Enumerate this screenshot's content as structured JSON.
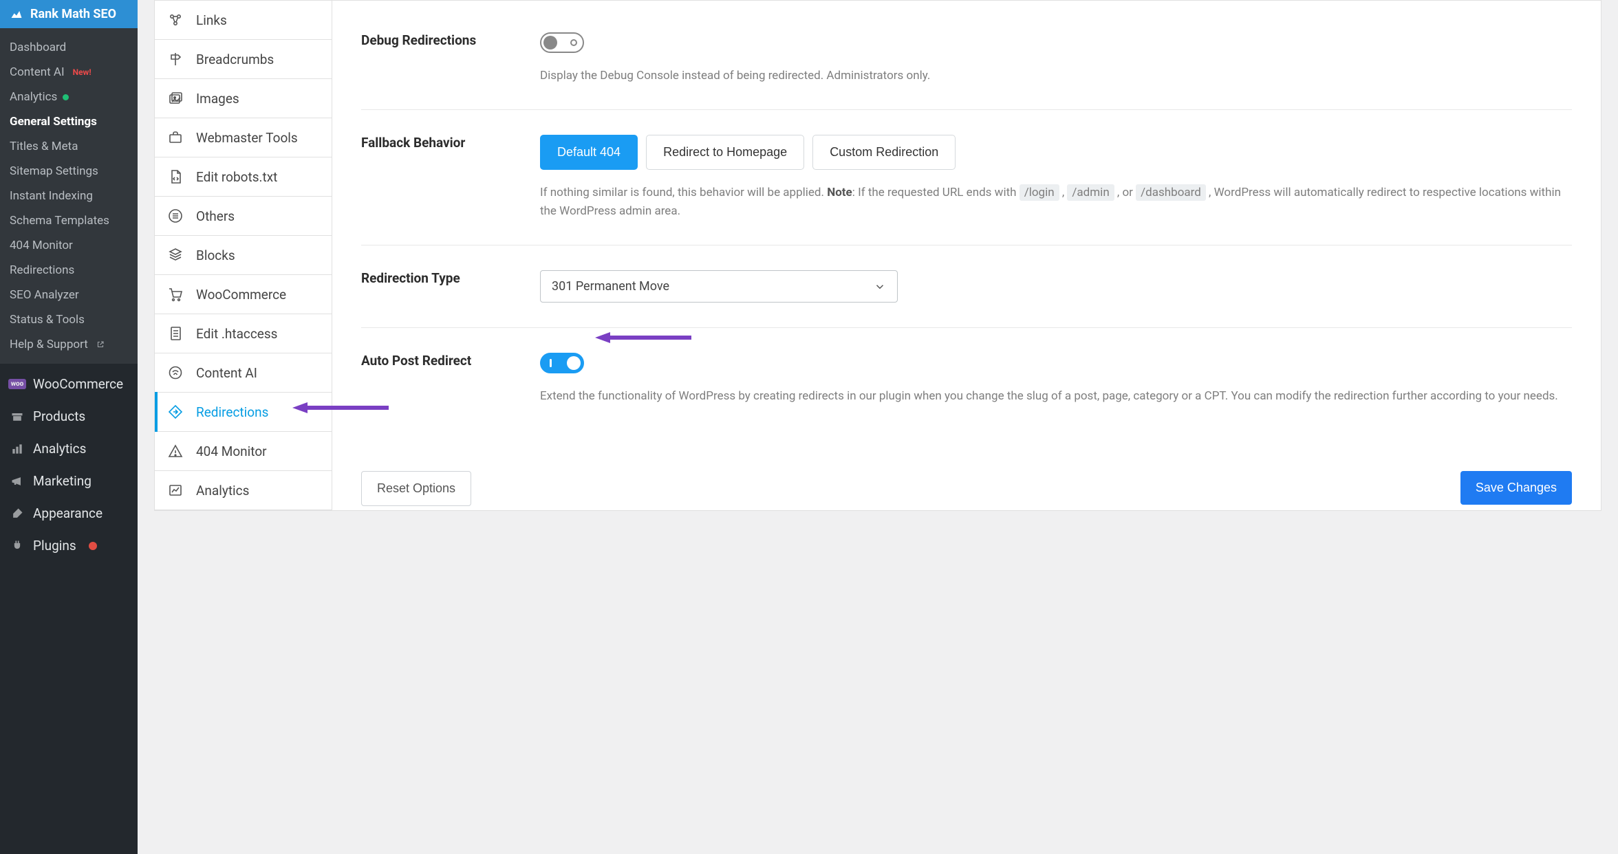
{
  "wp_sidebar": {
    "plugin_name": "Rank Math SEO",
    "submenu": [
      {
        "label": "Dashboard"
      },
      {
        "label": "Content AI",
        "badge_new": "New!"
      },
      {
        "label": "Analytics",
        "dot": true
      },
      {
        "label": "General Settings",
        "current": true
      },
      {
        "label": "Titles & Meta"
      },
      {
        "label": "Sitemap Settings"
      },
      {
        "label": "Instant Indexing"
      },
      {
        "label": "Schema Templates"
      },
      {
        "label": "404 Monitor"
      },
      {
        "label": "Redirections"
      },
      {
        "label": "SEO Analyzer"
      },
      {
        "label": "Status & Tools"
      },
      {
        "label": "Help & Support",
        "ext": true
      }
    ],
    "main_menu": [
      {
        "label": "WooCommerce",
        "icon": "woo"
      },
      {
        "label": "Products",
        "icon": "archive"
      },
      {
        "label": "Analytics",
        "icon": "bars"
      },
      {
        "label": "Marketing",
        "icon": "megaphone"
      },
      {
        "label": "Appearance",
        "icon": "brush"
      },
      {
        "label": "Plugins",
        "icon": "plug",
        "red_dot": true
      }
    ]
  },
  "tabs": [
    {
      "label": "Links",
      "icon": "links"
    },
    {
      "label": "Breadcrumbs",
      "icon": "sign"
    },
    {
      "label": "Images",
      "icon": "images"
    },
    {
      "label": "Webmaster Tools",
      "icon": "briefcase"
    },
    {
      "label": "Edit robots.txt",
      "icon": "file-code"
    },
    {
      "label": "Others",
      "icon": "list"
    },
    {
      "label": "Blocks",
      "icon": "blocks"
    },
    {
      "label": "WooCommerce",
      "icon": "cart"
    },
    {
      "label": "Edit .htaccess",
      "icon": "file-lines"
    },
    {
      "label": "Content AI",
      "icon": "ai"
    },
    {
      "label": "Redirections",
      "icon": "redirect",
      "active": true
    },
    {
      "label": "404 Monitor",
      "icon": "warn"
    },
    {
      "label": "Analytics",
      "icon": "chart"
    }
  ],
  "settings": {
    "debug": {
      "label": "Debug Redirections",
      "on": false,
      "desc": "Display the Debug Console instead of being redirected. Administrators only."
    },
    "fallback": {
      "label": "Fallback Behavior",
      "options": [
        "Default 404",
        "Redirect to Homepage",
        "Custom Redirection"
      ],
      "selected_index": 0,
      "desc_pre": "If nothing similar is found, this behavior will be applied. ",
      "desc_note_label": "Note",
      "desc_note": ": If the requested URL ends with ",
      "code1": "/login",
      "code2": "/admin",
      "code3": "/dashboard",
      "desc_tail": ", WordPress will automatically redirect to respective locations within the WordPress admin area."
    },
    "redir_type": {
      "label": "Redirection Type",
      "value": "301 Permanent Move"
    },
    "auto_post": {
      "label": "Auto Post Redirect",
      "on": true,
      "desc": "Extend the functionality of WordPress by creating redirects in our plugin when you change the slug of a post, page, category or a CPT. You can modify the redirection further according to your needs."
    }
  },
  "footer": {
    "reset": "Reset Options",
    "save": "Save Changes"
  }
}
